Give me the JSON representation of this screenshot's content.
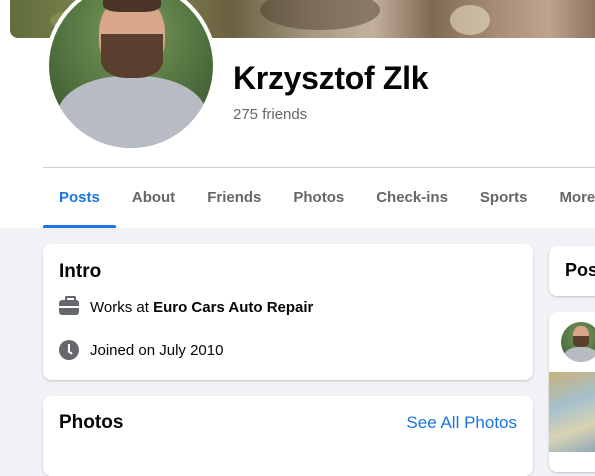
{
  "profile": {
    "name": "Krzysztof Zlk",
    "friends": "275 friends"
  },
  "tabs": [
    {
      "label": "Posts",
      "active": true
    },
    {
      "label": "About"
    },
    {
      "label": "Friends"
    },
    {
      "label": "Photos"
    },
    {
      "label": "Check-ins"
    },
    {
      "label": "Sports"
    },
    {
      "label": "More"
    }
  ],
  "intro": {
    "title": "Intro",
    "work_prefix": "Works at ",
    "work_place": "Euro Cars Auto Repair",
    "joined": "Joined on July 2010"
  },
  "photos": {
    "title": "Photos",
    "see_all": "See All Photos"
  },
  "side_card": {
    "title_partial": "Pos"
  },
  "icons": {
    "work": "briefcase-icon",
    "joined": "clock-icon",
    "more": "caret-down-icon"
  },
  "colors": {
    "accent": "#1b74e4",
    "background": "#f0f2f5",
    "secondary_text": "#65676b"
  }
}
